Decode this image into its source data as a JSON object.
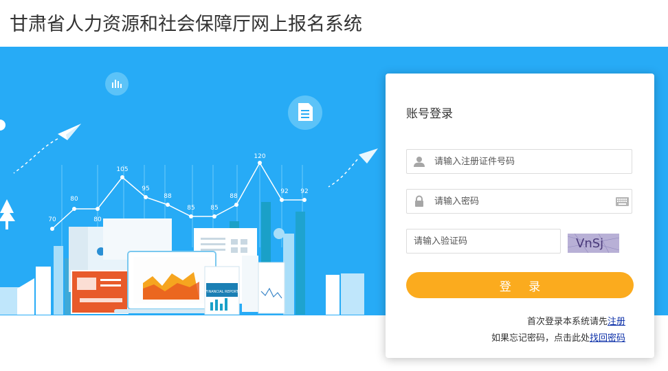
{
  "header": {
    "title": "甘肃省人力资源和社会保障厅网上报名系统"
  },
  "banner": {
    "line_values": [
      "70",
      "80",
      "80",
      "105",
      "95",
      "88",
      "85",
      "85",
      "88",
      "120",
      "92",
      "92"
    ],
    "report_label": "FINANCIAL REPORT"
  },
  "login": {
    "title": "账号登录",
    "id_placeholder": "请输入注册证件号码",
    "password_placeholder": "请输入密码",
    "captcha_placeholder": "请输入验证码",
    "captcha_text": "VnSj",
    "button_label": "登 录",
    "register_prefix": "首次登录本系统请先",
    "register_link": "注册",
    "forgot_prefix": "如果忘记密码，点击此处",
    "forgot_link": "找回密码"
  },
  "colors": {
    "banner": "#27abf6",
    "button": "#fbab1e",
    "link": "#0b2fa8"
  }
}
